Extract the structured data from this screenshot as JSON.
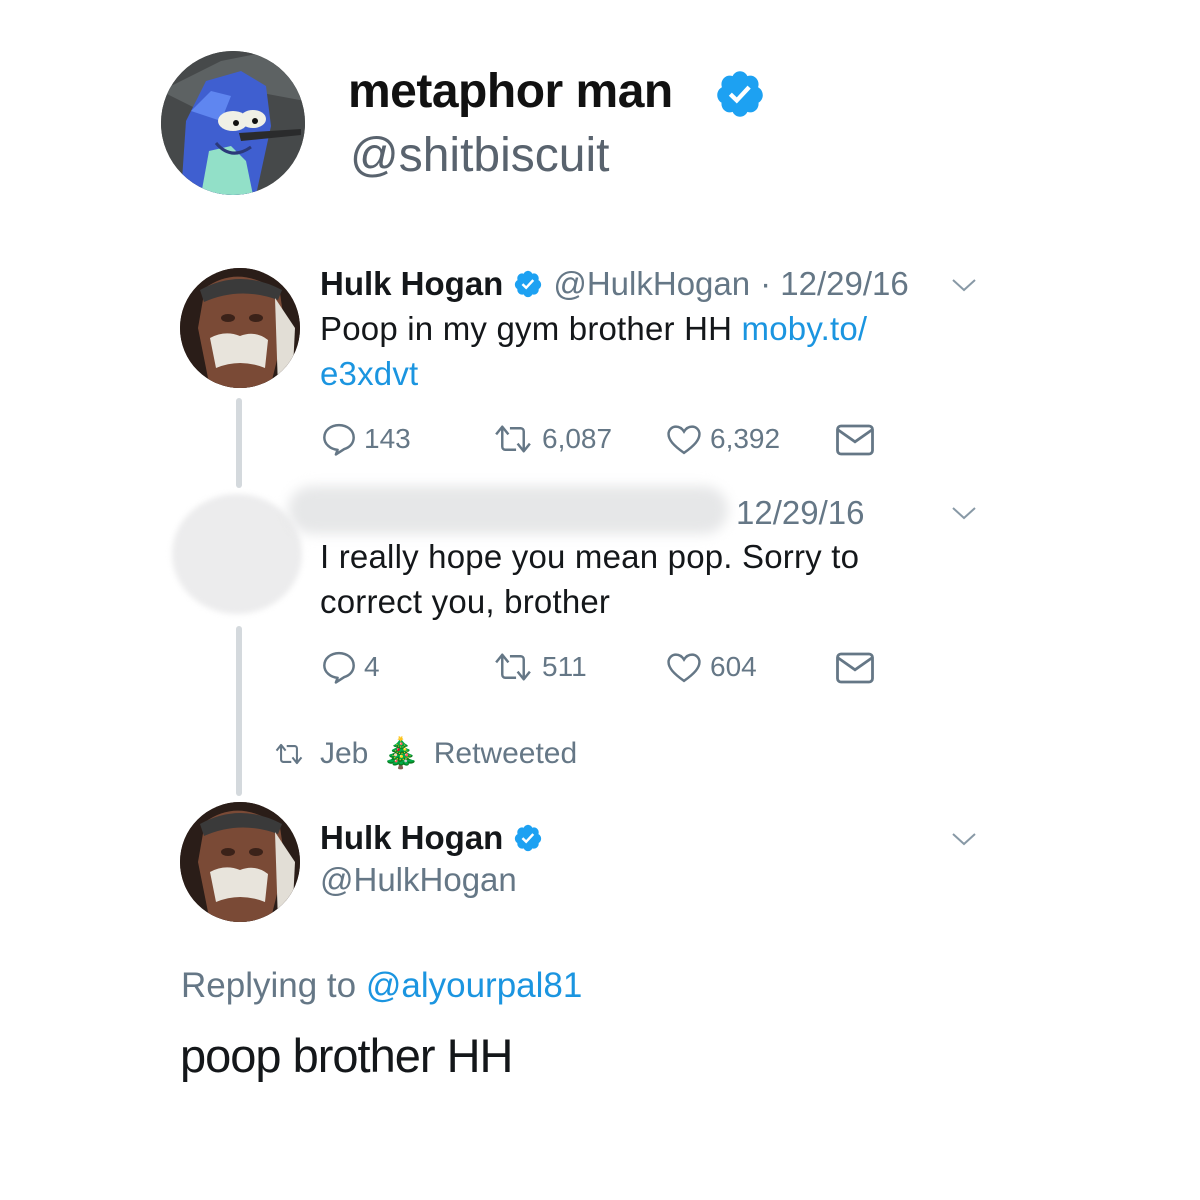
{
  "profile": {
    "display_name": "metaphor man",
    "handle": "@shitbiscuit"
  },
  "colors": {
    "verified": "#1da1f2",
    "link": "#1b95e0",
    "meta_gray": "#657786",
    "thread_line": "#d4d9dd"
  },
  "tweets": [
    {
      "name": "Hulk Hogan",
      "handle": "@HulkHogan",
      "date": "· 12/29/16",
      "text_before_link": "Poop in my gym brother HH ",
      "link_line1": "moby.to/",
      "link_line2": "e3xdvt",
      "replies": "143",
      "retweets": "6,087",
      "likes": "6,392"
    },
    {
      "date": "12/29/16",
      "text_line1": "I really hope you mean pop. Sorry to",
      "text_line2": "correct you, brother",
      "replies": "4",
      "retweets": "511",
      "likes": "604"
    }
  ],
  "retweet_banner": {
    "user": "Jeb",
    "emoji": "🎄",
    "label": "Retweeted"
  },
  "main_tweet": {
    "name": "Hulk Hogan",
    "handle": "@HulkHogan",
    "replying_label": "Replying to",
    "replying_to": "@alyourpal81",
    "text": "poop brother HH"
  },
  "icons": [
    "verified-badge-icon",
    "chevron-down-icon",
    "reply-icon",
    "retweet-icon",
    "like-icon",
    "dm-icon"
  ]
}
